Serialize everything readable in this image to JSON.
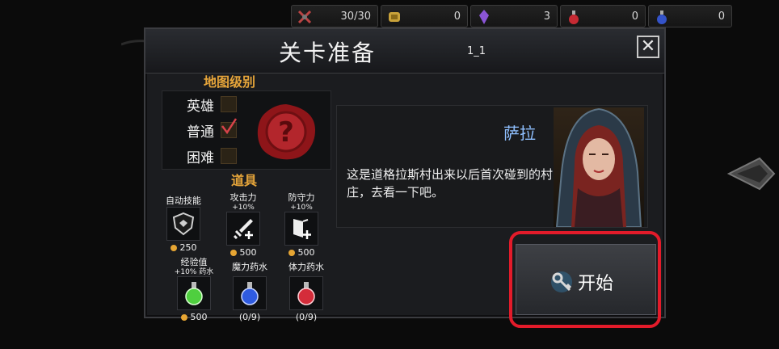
{
  "resources": [
    {
      "icon": "crossed-axes-icon",
      "value": "30/30"
    },
    {
      "icon": "gold-scroll-icon",
      "value": "0"
    },
    {
      "icon": "purple-crystal-icon",
      "value": "3"
    },
    {
      "icon": "red-potion-icon",
      "value": "0"
    },
    {
      "icon": "blue-potion-icon",
      "value": "0"
    }
  ],
  "dialog": {
    "title": "关卡准备",
    "stage": "1_1",
    "close_symbol": "✕"
  },
  "map_level": {
    "header": "地图级别",
    "options": [
      {
        "label": "英雄",
        "checked": false
      },
      {
        "label": "普通",
        "checked": true
      },
      {
        "label": "困难",
        "checked": false
      }
    ],
    "seal_symbol": "?"
  },
  "items": {
    "header": "道具",
    "list": [
      {
        "name": "自动技能",
        "sub": "",
        "cost": "250",
        "icon": "shield-icon"
      },
      {
        "name": "攻击力",
        "sub": "+10%",
        "cost": "500",
        "icon": "sword-plus-icon"
      },
      {
        "name": "防守力",
        "sub": "+10%",
        "cost": "500",
        "icon": "shield-plus-icon"
      },
      {
        "name": "经验值",
        "sub": "+10% 药水",
        "cost": "500",
        "icon": "green-potion-icon"
      },
      {
        "name": "魔力药水",
        "sub": "",
        "cost": "(0/9)",
        "icon": "blue-potion-icon"
      },
      {
        "name": "体力药水",
        "sub": "",
        "cost": "(0/9)",
        "icon": "red-potion-icon"
      }
    ]
  },
  "story": {
    "npc_name": "萨拉",
    "text": "这是道格拉斯村出来以后首次碰到的村庄，去看一下吧。"
  },
  "start_button": {
    "label": "开始",
    "icon": "key-icon"
  },
  "colors": {
    "accent_orange": "#e6a53a",
    "name_blue": "#8fc0ff",
    "highlight_red": "#e31b2a",
    "coin": "#e6a533"
  }
}
